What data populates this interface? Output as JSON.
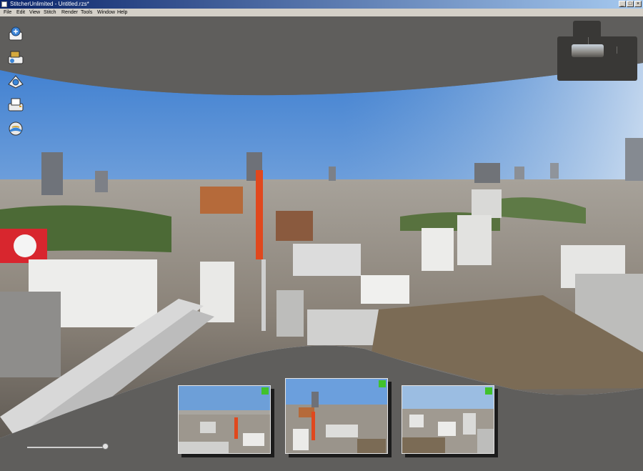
{
  "window": {
    "title": "StitcherUnlimited - Untitled.rzs*"
  },
  "menu": [
    "File",
    "Edit",
    "View",
    "Stitch",
    "Render",
    "Tools",
    "Window",
    "Help"
  ],
  "toolbar": {
    "tools": [
      {
        "icon": "import-images-icon"
      },
      {
        "icon": "stitch-images-icon"
      },
      {
        "icon": "panorama-settings-icon"
      },
      {
        "icon": "render-output-icon"
      },
      {
        "icon": "globe-view-icon"
      }
    ]
  },
  "thumbnails": [
    {
      "icon": "green-status-icon"
    },
    {
      "icon": "green-status-icon"
    },
    {
      "icon": "green-status-icon"
    }
  ],
  "zoom_slider": {
    "level": 0.97
  },
  "colors": {
    "accent_status": "#41c12c",
    "workspace": "#5f5e5c",
    "panel": "#393836"
  }
}
